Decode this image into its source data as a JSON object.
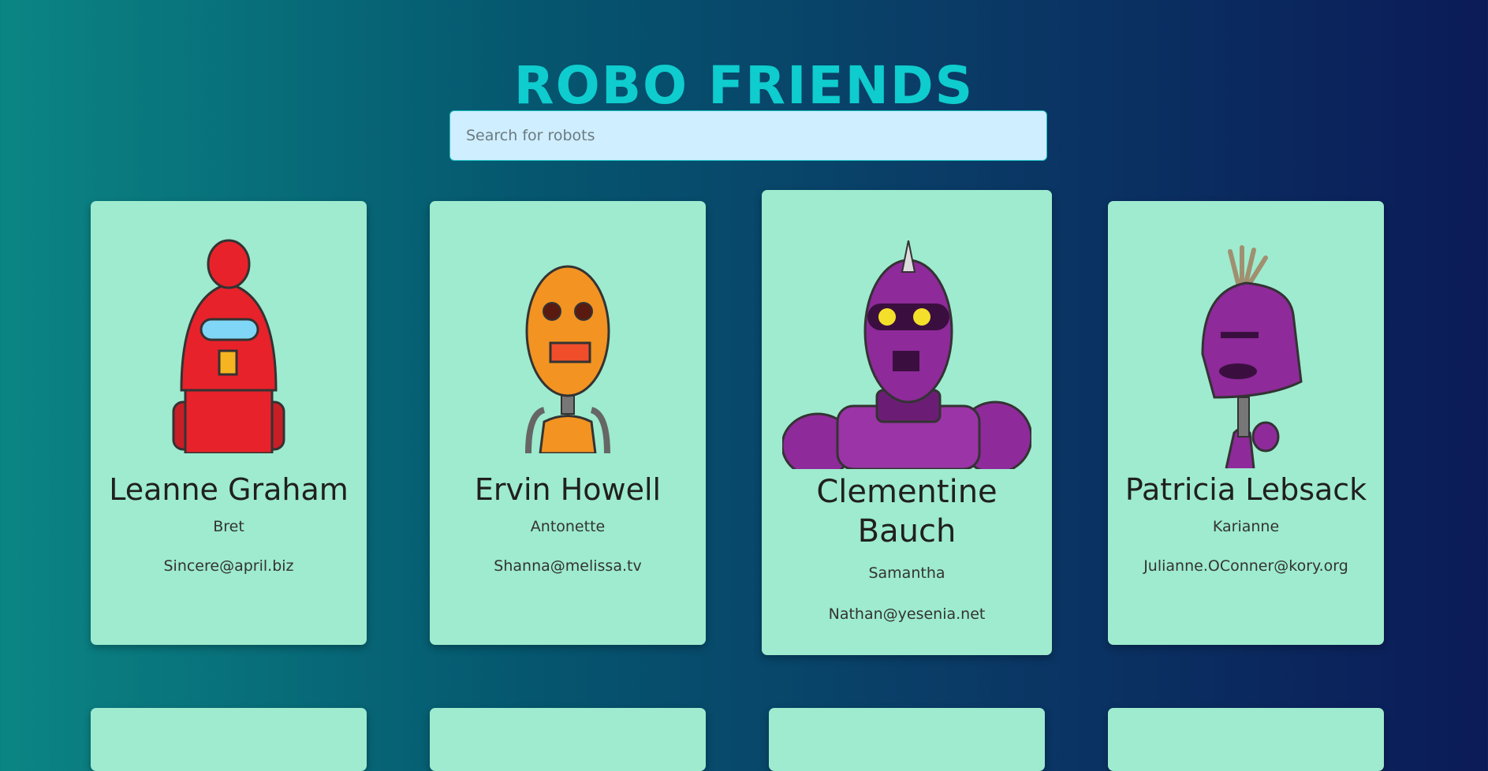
{
  "header": {
    "title": "ROBO FRIENDS"
  },
  "search": {
    "placeholder": "Search for robots"
  },
  "robots": [
    {
      "name": "Leanne Graham",
      "username": "Bret",
      "email": "Sincere@april.biz",
      "color": "#e8222a"
    },
    {
      "name": "Ervin Howell",
      "username": "Antonette",
      "email": "Shanna@melissa.tv",
      "color": "#f39322"
    },
    {
      "name": "Clementine Bauch",
      "username": "Samantha",
      "email": "Nathan@yesenia.net",
      "color": "#8e2a9a"
    },
    {
      "name": "Patricia Lebsack",
      "username": "Karianne",
      "email": "Julianne.OConner@kory.org",
      "color": "#8e2a9a"
    }
  ],
  "colors": {
    "card": "#9eebcf",
    "title": "#0fccce",
    "search_bg": "#cfeeff"
  }
}
